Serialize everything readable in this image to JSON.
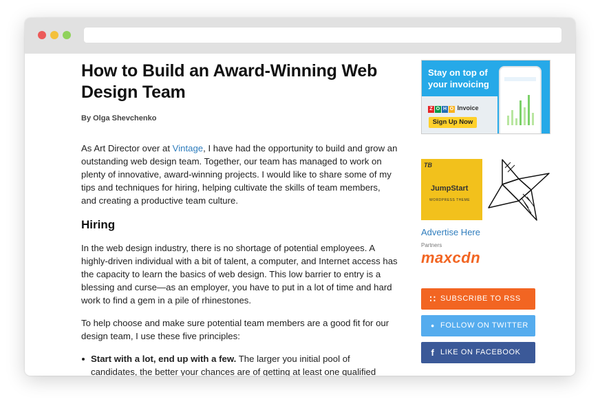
{
  "article": {
    "title": "How to Build an Award-Winning Web Design Team",
    "byline": "By Olga Shevchenko",
    "intro_before_link": "As Art Director over at ",
    "intro_link": "Vintage",
    "intro_after_link": ", I have had the opportunity to build and grow an outstanding web design team. Together, our team has managed to work on plenty of innovative, award-winning projects. I would like to share some of my tips and techniques for hiring, helping cultivate the skills of team members, and creating a productive team culture.",
    "hiring_heading": "Hiring",
    "hiring_para": "In the web design industry, there is no shortage of potential employees. A highly-driven individual with a bit of talent, a computer, and Internet access has the capacity to learn the basics of web design. This low barrier to entry is a blessing and curse—as an employer, you have to put in a lot of time and hard work to find a gem in a pile of rhinestones.",
    "principles_para": "To help choose and make sure potential team members are a good fit for our design team, I use these five principles:",
    "list_item_bold": "Start with a lot, end up with a few.",
    "list_item_text": " The larger you initial pool of candidates, the better your chances are of getting at least one qualified candidate to the"
  },
  "sidebar": {
    "zoho_ad": {
      "headline": "Stay on top of your invoicing",
      "brand": "Invoice",
      "zoho_letters": [
        "Z",
        "O",
        "H",
        "O"
      ],
      "zoho_colors": [
        "#e42527",
        "#089949",
        "#226db4",
        "#f9b21d"
      ],
      "cta": "Sign Up Now"
    },
    "jumpstart_ad": {
      "badge": "TB",
      "name": "JumpStart",
      "subtitle": "WORDPRESS THEME"
    },
    "advertise_link": "Advertise Here",
    "partners_label": "Partners",
    "partner_logo": "maxcdn",
    "buttons": {
      "rss": "SUBSCRIBE TO RSS",
      "twitter": "FOLLOW ON TWITTER",
      "facebook": "LIKE ON FACEBOOK"
    }
  }
}
